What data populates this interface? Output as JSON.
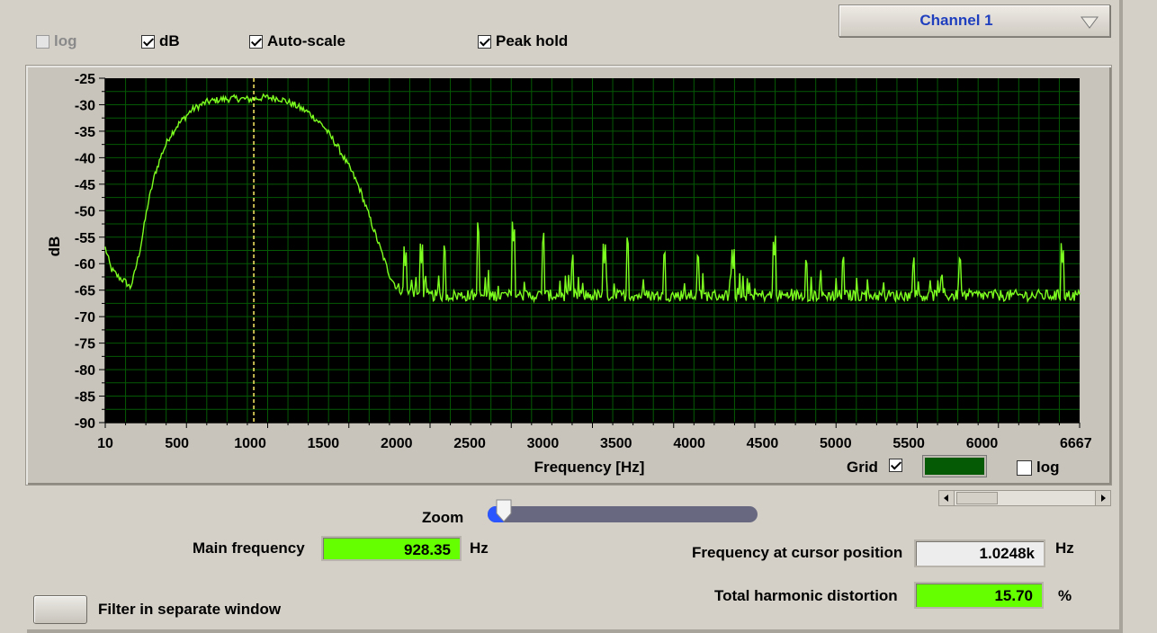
{
  "top_checkboxes": {
    "log": {
      "label": "log",
      "checked": false,
      "enabled": false
    },
    "db": {
      "label": "dB",
      "checked": true,
      "enabled": true
    },
    "autoscale": {
      "label": "Auto-scale",
      "checked": true,
      "enabled": true
    },
    "peak_hold": {
      "label": "Peak hold",
      "checked": true,
      "enabled": true
    }
  },
  "channel_select": {
    "value": "Channel 1"
  },
  "graph": {
    "grid": {
      "label": "Grid",
      "checked": true
    },
    "grid_color": "#055a05",
    "log_x": {
      "label": "log",
      "checked": false
    }
  },
  "chart_data": {
    "type": "line",
    "xlabel": "Frequency [Hz]",
    "ylabel": "dB",
    "xlim": [
      10,
      6667
    ],
    "ylim": [
      -90,
      -25
    ],
    "x_ticks": [
      "10",
      "500",
      "1000",
      "1500",
      "2000",
      "2500",
      "3000",
      "3500",
      "4000",
      "4500",
      "5000",
      "5500",
      "6000",
      "6667"
    ],
    "y_ticks": [
      "-25",
      "-30",
      "-35",
      "-40",
      "-45",
      "-50",
      "-55",
      "-60",
      "-65",
      "-70",
      "-75",
      "-80",
      "-85",
      "-90"
    ],
    "grid": true,
    "background_color": "#000000",
    "line_color": "#7dff1f",
    "cursor_color": "#ffee66",
    "cursor_x": 1024.8,
    "series": [
      {
        "x": [
          10,
          50,
          100,
          150,
          180,
          200,
          250,
          300,
          350,
          400,
          450,
          500,
          550,
          600,
          700,
          800,
          900,
          1000,
          1100,
          1200,
          1300,
          1400,
          1500,
          1600,
          1700,
          1750,
          1800,
          1850,
          1900,
          1950,
          2000,
          2100,
          2200,
          2400,
          2600,
          3000,
          4000,
          5000,
          6000,
          6667
        ],
        "y": [
          -57,
          -61,
          -62.5,
          -63.5,
          -64.5,
          -63,
          -57,
          -49,
          -43,
          -39,
          -36,
          -34,
          -32.5,
          -31,
          -29.5,
          -29,
          -28.8,
          -29,
          -28.6,
          -28.8,
          -30,
          -31.5,
          -34,
          -38,
          -43,
          -46,
          -50,
          -54,
          -58,
          -62,
          -64.5,
          -65.5,
          -66,
          -66,
          -66,
          -66,
          -66,
          -66,
          -66,
          -66
        ]
      }
    ],
    "peaks": [
      {
        "x": 2060,
        "y": -61
      },
      {
        "x": 2170,
        "y": -60
      },
      {
        "x": 2330,
        "y": -59
      },
      {
        "x": 2560,
        "y": -55
      },
      {
        "x": 2800,
        "y": -56.5
      },
      {
        "x": 3000,
        "y": -57
      },
      {
        "x": 3200,
        "y": -61
      },
      {
        "x": 3420,
        "y": -60
      },
      {
        "x": 3580,
        "y": -57.5
      },
      {
        "x": 3830,
        "y": -60
      },
      {
        "x": 4060,
        "y": -60.5
      },
      {
        "x": 4300,
        "y": -61
      },
      {
        "x": 4580,
        "y": -59
      },
      {
        "x": 4800,
        "y": -61.5
      },
      {
        "x": 5050,
        "y": -61
      },
      {
        "x": 5530,
        "y": -61.5
      },
      {
        "x": 5850,
        "y": -61
      },
      {
        "x": 6550,
        "y": -60.5
      }
    ]
  },
  "zoom": {
    "label": "Zoom",
    "value_fraction": 0.06
  },
  "main_frequency": {
    "label": "Main frequency",
    "value": "928.35",
    "unit": "Hz"
  },
  "cursor_frequency": {
    "label": "Frequency at cursor position",
    "value": "1.0248k",
    "unit": "Hz"
  },
  "thd": {
    "label": "Total harmonic distortion",
    "value": "15.70",
    "unit": "%"
  },
  "filter_button": {
    "label": "Filter in separate window"
  }
}
